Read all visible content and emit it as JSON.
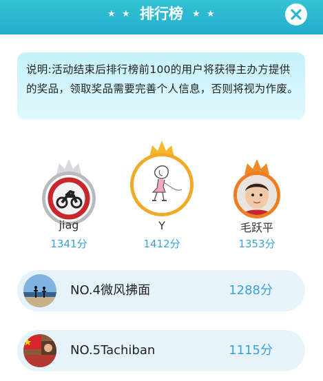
{
  "header": {
    "title": "排行榜",
    "star_glyph": "★",
    "close_icon": "close-icon"
  },
  "notice": {
    "text": "说明:活动结束后排行榜前100的用户将获得主办方提供的奖品，领取奖品需要完善个人信息，否则将视为作废。"
  },
  "podium": [
    {
      "name": "jiag",
      "score": "1341分",
      "crown_color": "#d8d8de",
      "ring_color": "#b9b9c0",
      "avatar_icon": "motorcycle-prohibited-sign-avatar"
    },
    {
      "name": "Y",
      "score": "1412分",
      "crown_color": "#f5b82a",
      "ring_color": "#f1a928",
      "avatar_icon": "girl-sketch-avatar"
    },
    {
      "name": "毛跃平",
      "score": "1353分",
      "crown_color": "#ef8a2b",
      "ring_color": "#ee7d22",
      "avatar_icon": "child-photo-avatar"
    }
  ],
  "ranks": [
    {
      "label": "NO.4微风拂面",
      "score": "1288分",
      "avatar_icon": "beach-photo-avatar"
    },
    {
      "label": "NO.5Tachiban",
      "score": "1115分",
      "avatar_icon": "flag-photo-avatar"
    }
  ],
  "colors": {
    "header_bg": "#28b4cf",
    "score_blue": "#3aa0d8",
    "row_bg": "#e6f3fb",
    "notice_bg": "#d4f5fb"
  }
}
